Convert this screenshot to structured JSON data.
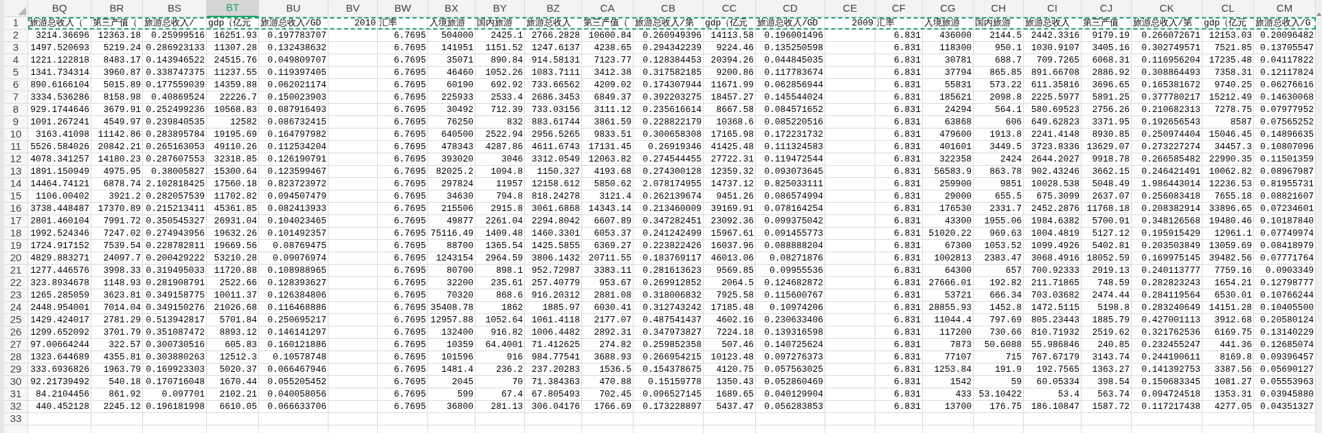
{
  "columns": [
    {
      "letter": "BQ",
      "selected": false
    },
    {
      "letter": "BR",
      "selected": false
    },
    {
      "letter": "BS",
      "selected": false
    },
    {
      "letter": "BT",
      "selected": true
    },
    {
      "letter": "BU",
      "selected": false
    },
    {
      "letter": "BV",
      "selected": false
    },
    {
      "letter": "BW",
      "selected": false
    },
    {
      "letter": "BX",
      "selected": false
    },
    {
      "letter": "BY",
      "selected": false
    },
    {
      "letter": "BZ",
      "selected": false
    },
    {
      "letter": "CA",
      "selected": false
    },
    {
      "letter": "CB",
      "selected": false
    },
    {
      "letter": "CC",
      "selected": false
    },
    {
      "letter": "CD",
      "selected": false
    },
    {
      "letter": "CE",
      "selected": false
    },
    {
      "letter": "CF",
      "selected": false
    },
    {
      "letter": "CG",
      "selected": false
    },
    {
      "letter": "CH",
      "selected": false
    },
    {
      "letter": "CI",
      "selected": false
    },
    {
      "letter": "CJ",
      "selected": false
    },
    {
      "letter": "CK",
      "selected": false
    },
    {
      "letter": "CL",
      "selected": false
    },
    {
      "letter": "CM",
      "selected": false
    }
  ],
  "rows": [
    {
      "number": "1",
      "copied": true,
      "cells": [
        {
          "text": "旅游总收入（",
          "kind": "text"
        },
        {
          "text": "第三产值（",
          "kind": "text"
        },
        {
          "text": "旅游总收入/",
          "kind": "text"
        },
        {
          "text": "gdp（亿元",
          "kind": "text"
        },
        {
          "text": "旅游总收入/GD",
          "kind": "text"
        },
        {
          "text": "2010",
          "kind": "number"
        },
        {
          "text": "汇率",
          "kind": "text"
        },
        {
          "text": "入境旅游",
          "kind": "text"
        },
        {
          "text": "国内旅游",
          "kind": "text"
        },
        {
          "text": "旅游总收入",
          "kind": "text"
        },
        {
          "text": "第三产值（",
          "kind": "text"
        },
        {
          "text": "旅游总收入/第",
          "kind": "text"
        },
        {
          "text": "gdp（亿元",
          "kind": "text"
        },
        {
          "text": "旅游总收入/GD",
          "kind": "text"
        },
        {
          "text": "2009",
          "kind": "number"
        },
        {
          "text": "汇率",
          "kind": "text"
        },
        {
          "text": "入境旅游",
          "kind": "text"
        },
        {
          "text": "国内旅游",
          "kind": "text"
        },
        {
          "text": "旅游总收入",
          "kind": "text"
        },
        {
          "text": "第三产值",
          "kind": "text"
        },
        {
          "text": "旅游总收入/第",
          "kind": "text"
        },
        {
          "text": "gdp（亿元",
          "kind": "text"
        },
        {
          "text": "旅游总收入/G",
          "kind": "text"
        }
      ]
    },
    {
      "number": "2",
      "cells": [
        "3214.36696",
        "12363.18",
        "0.25999516",
        "16251.93",
        "0.197783707",
        null,
        "6.7695",
        "504000",
        "2425.1",
        "2766.2828",
        "10600.84",
        "0.260949396",
        "14113.58",
        "0.196001496",
        null,
        "6.831",
        "436000",
        "2144.5",
        "2442.3316",
        "9179.19",
        "0.266072671",
        "12153.03",
        "0.20096482"
      ]
    },
    {
      "number": "3",
      "cells": [
        "1497.520693",
        "5219.24",
        "0.286923133",
        "11307.28",
        "0.132438632",
        null,
        "6.7695",
        "141951",
        "1151.52",
        "1247.6137",
        "4238.65",
        "0.294342239",
        "9224.46",
        "0.135250598",
        null,
        "6.831",
        "118300",
        "950.1",
        "1030.9107",
        "3405.16",
        "0.302749571",
        "7521.85",
        "0.13705547"
      ]
    },
    {
      "number": "4",
      "cells": [
        "1221.122818",
        "8483.17",
        "0.143946522",
        "24515.76",
        "0.049809707",
        null,
        "6.7695",
        "35071",
        "890.84",
        "914.58131",
        "7123.77",
        "0.128384453",
        "20394.26",
        "0.044845035",
        null,
        "6.831",
        "30781",
        "688.7",
        "709.7265",
        "6068.31",
        "0.116956204",
        "17235.48",
        "0.04117822"
      ]
    },
    {
      "number": "5",
      "cells": [
        "1341.734314",
        "3960.87",
        "0.338747375",
        "11237.55",
        "0.119397405",
        null,
        "6.7695",
        "46460",
        "1052.26",
        "1083.7111",
        "3412.38",
        "0.317582185",
        "9200.86",
        "0.117783674",
        null,
        "6.831",
        "37794",
        "865.85",
        "891.66708",
        "2886.92",
        "0.308864493",
        "7358.31",
        "0.12117824"
      ]
    },
    {
      "number": "6",
      "cells": [
        "890.6166104",
        "5015.89",
        "0.177559039",
        "14359.88",
        "0.062021174",
        null,
        "6.7695",
        "60190",
        "692.92",
        "733.66562",
        "4209.02",
        "0.174307944",
        "11671.99",
        "0.062856944",
        null,
        "6.831",
        "55831",
        "573.22",
        "611.35816",
        "3696.65",
        "0.165381672",
        "9740.25",
        "0.06276616"
      ]
    },
    {
      "number": "7",
      "cells": [
        "3334.536286",
        "8158.98",
        "0.40869524",
        "22226.7",
        "0.150023903",
        null,
        "6.7695",
        "225933",
        "2533.4",
        "2686.3453",
        "6849.37",
        "0.392203275",
        "18457.27",
        "0.145544024",
        null,
        "6.831",
        "185621",
        "2098.8",
        "2225.5977",
        "5891.25",
        "0.377780217",
        "15212.49",
        "0.14630068"
      ]
    },
    {
      "number": "8",
      "cells": [
        "929.1744646",
        "3679.91",
        "0.252499236",
        "10568.83",
        "0.087916493",
        null,
        "6.7695",
        "30492",
        "712.39",
        "733.03156",
        "3111.12",
        "0.235616614",
        "8667.58",
        "0.084571652",
        null,
        "6.831",
        "24294",
        "564.1",
        "580.69523",
        "2756.26",
        "0.210682313",
        "7278.75",
        "0.07977952"
      ]
    },
    {
      "number": "9",
      "cells": [
        "1091.267241",
        "4549.97",
        "0.239840535",
        "12582",
        "0.086732415",
        null,
        "6.7695",
        "76250",
        "832",
        "883.61744",
        "3861.59",
        "0.228822179",
        "10368.6",
        "0.085220516",
        null,
        "6.831",
        "63868",
        "606",
        "649.62823",
        "3371.95",
        "0.192656543",
        "8587",
        "0.07565252"
      ]
    },
    {
      "number": "10",
      "cells": [
        "3163.41098",
        "11142.86",
        "0.283895784",
        "19195.69",
        "0.164797982",
        null,
        "6.7695",
        "640500",
        "2522.94",
        "2956.5265",
        "9833.51",
        "0.300658308",
        "17165.98",
        "0.172231732",
        null,
        "6.831",
        "479600",
        "1913.8",
        "2241.4148",
        "8930.85",
        "0.250974404",
        "15046.45",
        "0.14896635"
      ]
    },
    {
      "number": "11",
      "cells": [
        "5526.584026",
        "20842.21",
        "0.265163053",
        "49110.26",
        "0.112534204",
        null,
        "6.7695",
        "478343",
        "4287.86",
        "4611.6743",
        "17131.45",
        "0.26919346",
        "41425.48",
        "0.111324583",
        null,
        "6.831",
        "401601",
        "3449.5",
        "3723.8336",
        "13629.07",
        "0.273227274",
        "34457.3",
        "0.10807096"
      ]
    },
    {
      "number": "12",
      "cells": [
        "4078.341257",
        "14180.23",
        "0.287607553",
        "32318.85",
        "0.126190791",
        null,
        "6.7695",
        "393020",
        "3046",
        "3312.0549",
        "12063.82",
        "0.274544455",
        "27722.31",
        "0.119472544",
        null,
        "6.831",
        "322358",
        "2424",
        "2644.2027",
        "9918.78",
        "0.266585482",
        "22990.35",
        "0.11501359"
      ]
    },
    {
      "number": "13",
      "cells": [
        "1891.150949",
        "4975.95",
        "0.38005827",
        "15300.64",
        "0.123599467",
        null,
        "6.7695",
        "82025.2",
        "1094.8",
        "1150.327",
        "4193.68",
        "0.274300128",
        "12359.32",
        "0.093073645",
        null,
        "6.831",
        "56583.9",
        "863.78",
        "902.43246",
        "3662.15",
        "0.246421491",
        "10062.82",
        "0.08967987"
      ]
    },
    {
      "number": "14",
      "cells": [
        "14464.74121",
        "6878.74",
        "2.102818425",
        "17560.18",
        "0.823723972",
        null,
        "6.7695",
        "297824",
        "11957",
        "12158.612",
        "5850.62",
        "2.078174955",
        "14737.12",
        "0.825033111",
        null,
        "6.831",
        "259900",
        "9851",
        "10028.538",
        "5048.49",
        "1.986443014",
        "12236.53",
        "0.81955731"
      ]
    },
    {
      "number": "15",
      "cells": [
        "1106.00402",
        "3921.2",
        "0.282057539",
        "11702.82",
        "0.094507479",
        null,
        "6.7695",
        "34630",
        "794.8",
        "818.24278",
        "3121.4",
        "0.262139674",
        "9451.26",
        "0.086574994",
        null,
        "6.831",
        "29000",
        "655.5",
        "675.3099",
        "2637.07",
        "0.256083418",
        "7655.18",
        "0.08821607"
      ]
    },
    {
      "number": "16",
      "cells": [
        "3738.448487",
        "17370.89",
        "0.215213411",
        "45361.85",
        "0.082413933",
        null,
        "6.7695",
        "215506",
        "2915.8",
        "3061.6868",
        "14343.14",
        "0.213460009",
        "39169.91",
        "0.078164254",
        null,
        "6.831",
        "176530",
        "2331.7",
        "2452.2876",
        "11768.18",
        "0.208382914",
        "33896.65",
        "0.07234601"
      ]
    },
    {
      "number": "17",
      "cells": [
        "2801.460104",
        "7991.72",
        "0.350545327",
        "26931.04",
        "0.104023465",
        null,
        "6.7695",
        "49877",
        "2261.04",
        "2294.8042",
        "6607.89",
        "0.347282451",
        "23092.36",
        "0.099375042",
        null,
        "6.831",
        "43300",
        "1955.06",
        "1984.6382",
        "5700.91",
        "0.348126568",
        "19480.46",
        "0.10187840"
      ]
    },
    {
      "number": "18",
      "cells": [
        "1992.524346",
        "7247.02",
        "0.274943956",
        "19632.26",
        "0.101492357",
        null,
        "6.7695",
        "75116.49",
        "1409.48",
        "1460.3301",
        "6053.37",
        "0.241242499",
        "15967.61",
        "0.091455773",
        null,
        "6.831",
        "51020.22",
        "969.63",
        "1004.4819",
        "5127.12",
        "0.195915429",
        "12961.1",
        "0.07749974"
      ]
    },
    {
      "number": "19",
      "cells": [
        "1724.917152",
        "7539.54",
        "0.228782811",
        "19669.56",
        "0.08769475",
        null,
        "6.7695",
        "88700",
        "1365.54",
        "1425.5855",
        "6369.27",
        "0.223822426",
        "16037.96",
        "0.088888204",
        null,
        "6.831",
        "67300",
        "1053.52",
        "1099.4926",
        "5402.81",
        "0.203503849",
        "13059.69",
        "0.08418979"
      ]
    },
    {
      "number": "20",
      "cells": [
        "4829.883271",
        "24097.7",
        "0.200429222",
        "53210.28",
        "0.09076974",
        null,
        "6.7695",
        "1243154",
        "2964.59",
        "3806.1432",
        "20711.55",
        "0.183769117",
        "46013.06",
        "0.08271876",
        null,
        "6.831",
        "1002813",
        "2383.47",
        "3068.4916",
        "18052.59",
        "0.169975145",
        "39482.56",
        "0.07771764"
      ]
    },
    {
      "number": "21",
      "cells": [
        "1277.446576",
        "3998.33",
        "0.319495033",
        "11720.88",
        "0.108988965",
        null,
        "6.7695",
        "80700",
        "898.1",
        "952.72987",
        "3383.11",
        "0.281613623",
        "9569.85",
        "0.09955536",
        null,
        "6.831",
        "64300",
        "657",
        "700.92333",
        "2919.13",
        "0.240113777",
        "7759.16",
        "0.0903349"
      ]
    },
    {
      "number": "22",
      "cells": [
        "323.8934678",
        "1148.93",
        "0.281908791",
        "2522.66",
        "0.128393627",
        null,
        "6.7695",
        "32200",
        "235.61",
        "257.40779",
        "953.67",
        "0.269912852",
        "2064.5",
        "0.124682872",
        null,
        "6.831",
        "27666.01",
        "192.82",
        "211.71865",
        "748.59",
        "0.282823243",
        "1654.21",
        "0.12798777"
      ]
    },
    {
      "number": "23",
      "cells": [
        "1265.285059",
        "3623.81",
        "0.349158775",
        "10011.37",
        "0.126384806",
        null,
        "6.7695",
        "70320",
        "868.6",
        "916.20312",
        "2881.08",
        "0.318006832",
        "7925.58",
        "0.115600767",
        null,
        "6.831",
        "53721",
        "666.34",
        "703.03682",
        "2474.44",
        "0.284119564",
        "6530.01",
        "0.10766244"
      ]
    },
    {
      "number": "24",
      "cells": [
        "2448.954001",
        "7014.04",
        "0.349150276",
        "21026.68",
        "0.116468886",
        null,
        "6.7695",
        "35408.78",
        "1862",
        "1885.97",
        "6030.41",
        "0.312743242",
        "17185.48",
        "0.10974206",
        null,
        "6.831",
        "28855.93",
        "1452.8",
        "1472.5115",
        "5198.8",
        "0.283240649",
        "14151.28",
        "0.10405500"
      ]
    },
    {
      "number": "25",
      "cells": [
        "1429.424017",
        "2781.29",
        "0.513942817",
        "5701.84",
        "0.250695217",
        null,
        "6.7695",
        "12957.88",
        "1052.64",
        "1061.4118",
        "2177.07",
        "0.487541437",
        "4602.16",
        "0.230633406",
        null,
        "6.831",
        "11044.4",
        "797.69",
        "805.23443",
        "1885.79",
        "0.427001113",
        "3912.68",
        "0.20580124"
      ]
    },
    {
      "number": "26",
      "cells": [
        "1299.652092",
        "3701.79",
        "0.351087472",
        "8893.12",
        "0.146141297",
        null,
        "6.7695",
        "132400",
        "916.82",
        "1006.4482",
        "2892.31",
        "0.347973827",
        "7224.18",
        "0.139316598",
        null,
        "6.831",
        "117200",
        "730.66",
        "810.71932",
        "2519.62",
        "0.321762536",
        "6169.75",
        "0.13140229"
      ]
    },
    {
      "number": "27",
      "cells": [
        "97.00664244",
        "322.57",
        "0.300730516",
        "605.83",
        "0.160121886",
        null,
        "6.7695",
        "10359",
        "64.4001",
        "71.412625",
        "274.82",
        "0.259852358",
        "507.46",
        "0.140725624",
        null,
        "6.831",
        "7873",
        "50.6088",
        "55.986846",
        "240.85",
        "0.232455247",
        "441.36",
        "0.12685074"
      ]
    },
    {
      "number": "28",
      "cells": [
        "1323.644689",
        "4355.81",
        "0.303880263",
        "12512.3",
        "0.10578748",
        null,
        "6.7695",
        "101596",
        "916",
        "984.77541",
        "3688.93",
        "0.266954215",
        "10123.48",
        "0.097276373",
        null,
        "6.831",
        "77107",
        "715",
        "767.67179",
        "3143.74",
        "0.244190611",
        "8169.8",
        "0.09396457"
      ]
    },
    {
      "number": "29",
      "cells": [
        "333.6936826",
        "1963.79",
        "0.169923303",
        "5020.37",
        "0.066467946",
        null,
        "6.7695",
        "1481.4",
        "236.2",
        "237.20283",
        "1536.5",
        "0.154378675",
        "4120.75",
        "0.057563025",
        null,
        "6.831",
        "1253.84",
        "191.9",
        "192.7565",
        "1363.27",
        "0.141392753",
        "3387.56",
        "0.05690127"
      ]
    },
    {
      "number": "30",
      "cells": [
        "92.21739492",
        "540.18",
        "0.170716048",
        "1670.44",
        "0.055205452",
        null,
        "6.7695",
        "2045",
        "70",
        "71.384363",
        "470.88",
        "0.15159778",
        "1350.43",
        "0.052860469",
        null,
        "6.831",
        "1542",
        "59",
        "60.05334",
        "398.54",
        "0.150683345",
        "1081.27",
        "0.05553963"
      ]
    },
    {
      "number": "31",
      "cells": [
        "84.2104456",
        "861.92",
        "0.097701",
        "2102.21",
        "0.040058056",
        null,
        "6.7695",
        "599",
        "67.4",
        "67.805493",
        "702.45",
        "0.096527145",
        "1689.65",
        "0.040129904",
        null,
        "6.831",
        "433",
        "53.10422",
        "53.4",
        "563.74",
        "0.094724518",
        "1353.31",
        "0.03945880"
      ]
    },
    {
      "number": "32",
      "cells": [
        "440.452128",
        "2245.12",
        "0.196181998",
        "6610.05",
        "0.066633706",
        null,
        "6.7695",
        "36800",
        "281.13",
        "306.04176",
        "1766.69",
        "0.173228897",
        "5437.47",
        "0.056283853",
        null,
        "6.831",
        "13700",
        "176.75",
        "186.10847",
        "1587.72",
        "0.117217438",
        "4277.05",
        "0.04351327"
      ]
    },
    {
      "number": "33"
    }
  ]
}
